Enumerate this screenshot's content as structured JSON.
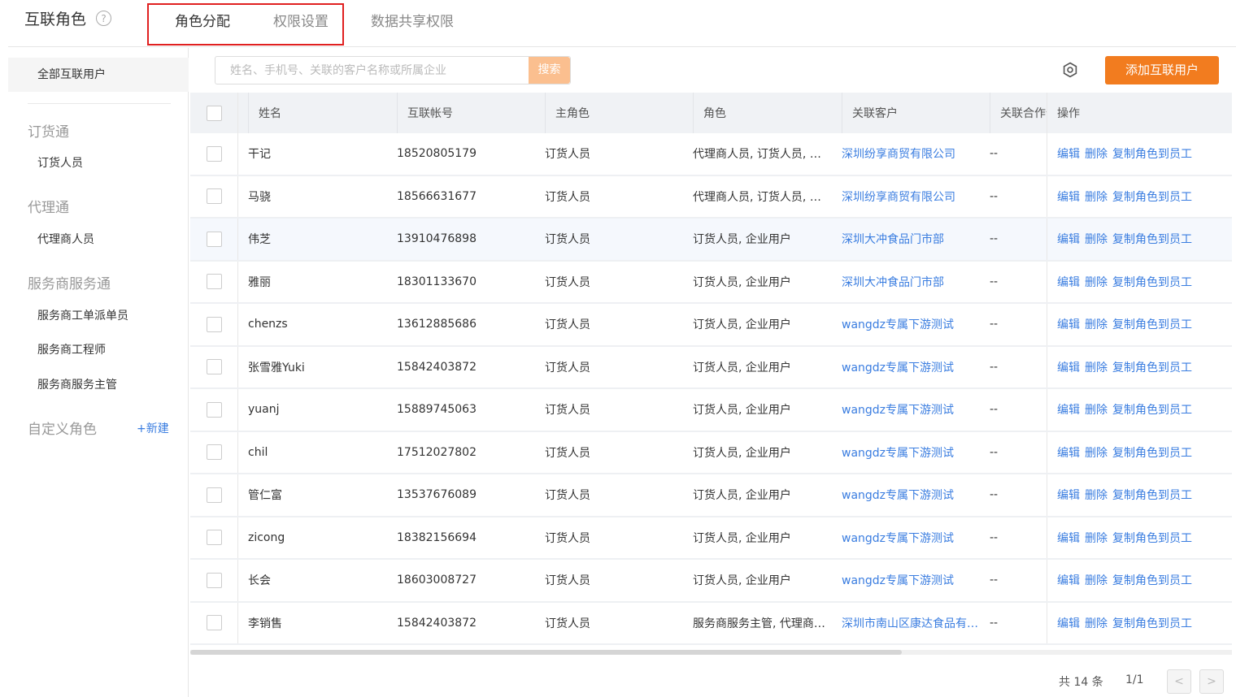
{
  "header": {
    "title": "互联角色",
    "help_icon": "?",
    "tabs": [
      {
        "label": "角色分配",
        "active": true
      },
      {
        "label": "权限设置",
        "active": false
      },
      {
        "label": "数据共享权限",
        "active": false
      }
    ]
  },
  "sidebar": {
    "all_users": "全部互联用户",
    "groups": [
      {
        "title": "订货通",
        "items": [
          "订货人员"
        ]
      },
      {
        "title": "代理通",
        "items": [
          "代理商人员"
        ]
      },
      {
        "title": "服务商服务通",
        "items": [
          "服务商工单派单员",
          "服务商工程师",
          "服务商服务主管"
        ]
      },
      {
        "title": "自定义角色",
        "items": []
      }
    ],
    "new_label": "+新建"
  },
  "toolbar": {
    "search_placeholder": "姓名、手机号、关联的客户名称或所属企业",
    "search_button": "搜索",
    "settings_icon": "settings-icon",
    "add_button": "添加互联用户"
  },
  "table": {
    "columns": [
      "姓名",
      "互联帐号",
      "主角色",
      "角色",
      "关联客户",
      "关联合作伙伴",
      "操作"
    ],
    "rows": [
      {
        "name": "干记",
        "account": "18520805179",
        "main_role": "订货人员",
        "roles": "代理商人员, 订货人员, 企业用户",
        "customer": "深圳纷享商贸有限公司",
        "partner": "--"
      },
      {
        "name": "马骁",
        "account": "18566631677",
        "main_role": "订货人员",
        "roles": "代理商人员, 订货人员, 企业用户",
        "customer": "深圳纷享商贸有限公司",
        "partner": "--"
      },
      {
        "name": "伟芝",
        "account": "13910476898",
        "main_role": "订货人员",
        "roles": "订货人员, 企业用户",
        "customer": "深圳大冲食品门市部",
        "partner": "--"
      },
      {
        "name": "雅丽",
        "account": "18301133670",
        "main_role": "订货人员",
        "roles": "订货人员, 企业用户",
        "customer": "深圳大冲食品门市部",
        "partner": "--"
      },
      {
        "name": "chenzs",
        "account": "13612885686",
        "main_role": "订货人员",
        "roles": "订货人员, 企业用户",
        "customer": "wangdz专属下游测试",
        "partner": "--"
      },
      {
        "name": "张雪雅Yuki",
        "account": "15842403872",
        "main_role": "订货人员",
        "roles": "订货人员, 企业用户",
        "customer": "wangdz专属下游测试",
        "partner": "--"
      },
      {
        "name": "yuanj",
        "account": "15889745063",
        "main_role": "订货人员",
        "roles": "订货人员, 企业用户",
        "customer": "wangdz专属下游测试",
        "partner": "--"
      },
      {
        "name": "chil",
        "account": "17512027802",
        "main_role": "订货人员",
        "roles": "订货人员, 企业用户",
        "customer": "wangdz专属下游测试",
        "partner": "--"
      },
      {
        "name": "管仁富",
        "account": "13537676089",
        "main_role": "订货人员",
        "roles": "订货人员, 企业用户",
        "customer": "wangdz专属下游测试",
        "partner": "--"
      },
      {
        "name": "zicong",
        "account": "18382156694",
        "main_role": "订货人员",
        "roles": "订货人员, 企业用户",
        "customer": "wangdz专属下游测试",
        "partner": "--"
      },
      {
        "name": "长会",
        "account": "18603008727",
        "main_role": "订货人员",
        "roles": "订货人员, 企业用户",
        "customer": "wangdz专属下游测试",
        "partner": "--"
      },
      {
        "name": "李销售",
        "account": "15842403872",
        "main_role": "订货人员",
        "roles": "服务商服务主管, 代理商人员, 订货人员",
        "customer": "深圳市南山区康达食品有限公司",
        "partner": "--"
      }
    ],
    "actions": [
      "编辑",
      "删除",
      "复制角色到员工"
    ],
    "highlighted_row": 2
  },
  "pagination": {
    "total": "共 14 条",
    "pages": "1/1",
    "prev": "<",
    "next": ">"
  },
  "colors": {
    "accent": "#f27c1f",
    "link": "#3a7de0",
    "search_button": "#fbbf8f",
    "highlight_border": "#e02020"
  }
}
